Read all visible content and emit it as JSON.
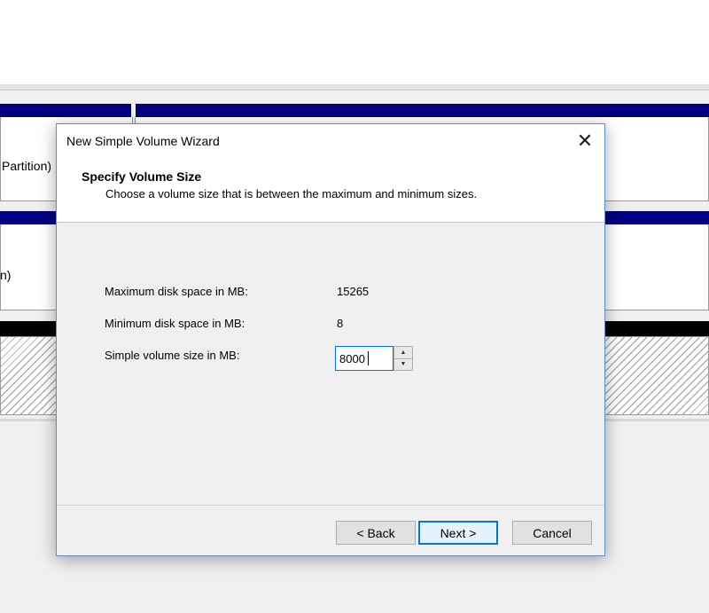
{
  "background": {
    "partition_1_label": "Partition)",
    "partition_2_label": "n)"
  },
  "dialog": {
    "title": "New Simple Volume Wizard",
    "close_glyph": "✕",
    "header_title": "Specify Volume Size",
    "header_subtitle": "Choose a volume size that is between the maximum and minimum sizes.",
    "fields": {
      "max_label": "Maximum disk space in MB:",
      "max_value": "15265",
      "min_label": "Minimum disk space in MB:",
      "min_value": "8",
      "size_label": "Simple volume size in MB:",
      "size_value": "8000"
    },
    "buttons": {
      "back": "< Back",
      "next": "Next >",
      "cancel": "Cancel"
    }
  },
  "colors": {
    "partition_bar": "#000080",
    "unallocated_bar": "#000000",
    "accent": "#0078d7"
  },
  "icons": {
    "close": "close-icon",
    "spin_up": "caret-up-icon",
    "spin_down": "caret-down-icon"
  }
}
